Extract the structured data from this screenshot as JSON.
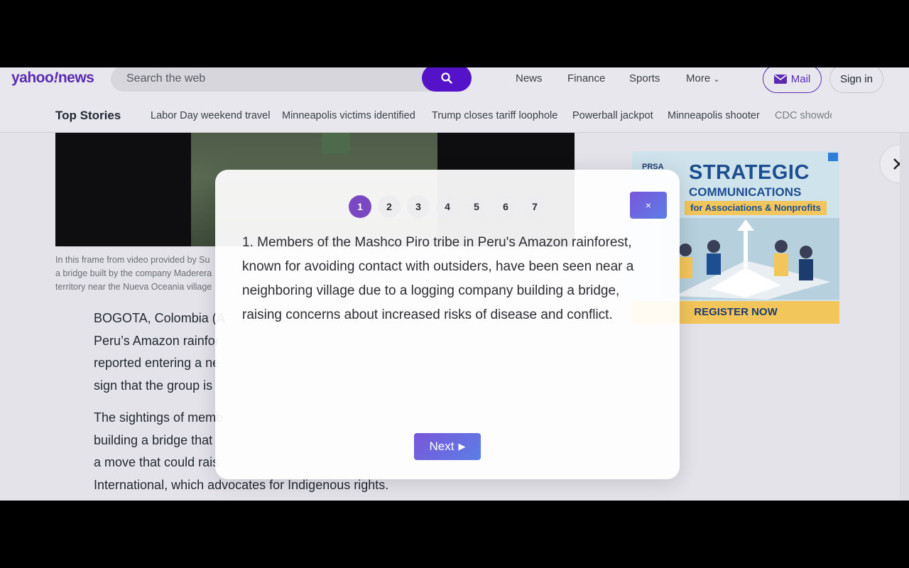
{
  "header": {
    "logo_main": "yahoo",
    "logo_bang": "!",
    "logo_suffix": "news",
    "search_placeholder": "Search the web",
    "nav": [
      "News",
      "Finance",
      "Sports",
      "More"
    ],
    "more_chevron": "⌄",
    "mail_label": "Mail",
    "signin_label": "Sign in",
    "brand_color": "#5413c9"
  },
  "topstories": {
    "title": "Top Stories",
    "items": [
      "Labor Day weekend travel",
      "Minneapolis victims identified",
      "Trump closes tariff loophole",
      "Powerball jackpot",
      "Minneapolis shooter",
      "CDC showdo"
    ]
  },
  "article": {
    "caption": "In this frame from video provided by Su… a bridge built by the company Maderera… territory near the Nueva Oceania village…",
    "caption_lines": [
      "In this frame from video provided by Su",
      "a bridge built by the company Maderera",
      "territory near the Nueva Oceania village"
    ],
    "p1_lines": [
      "BOGOTA, Colombia (A",
      "Peru’s Amazon rainfor",
      "reported entering a ne",
      "sign that the group is"
    ],
    "p2_lines": [
      "The sightings of memb",
      "building a bridge that",
      "a move that could rais",
      "International, which advocates for Indigenous rights."
    ]
  },
  "ad": {
    "logo": "PRSA",
    "title": "STRATEGIC",
    "subtitle": "COMMUNICATIONS",
    "strip": "for Associations & Nonprofits",
    "cta": "REGISTER NOW"
  },
  "modal": {
    "steps": [
      "1",
      "2",
      "3",
      "4",
      "5",
      "6",
      "7"
    ],
    "active_step": "1",
    "close_label": "×",
    "text": "1. Members of the Mashco Piro tribe in Peru's Amazon rainforest, known for avoiding contact with outsiders, have been seen near a neighboring village due to a logging company building a bridge, raising concerns about increased risks of disease and conflict.",
    "next_label": "Next",
    "next_icon": "▶"
  }
}
